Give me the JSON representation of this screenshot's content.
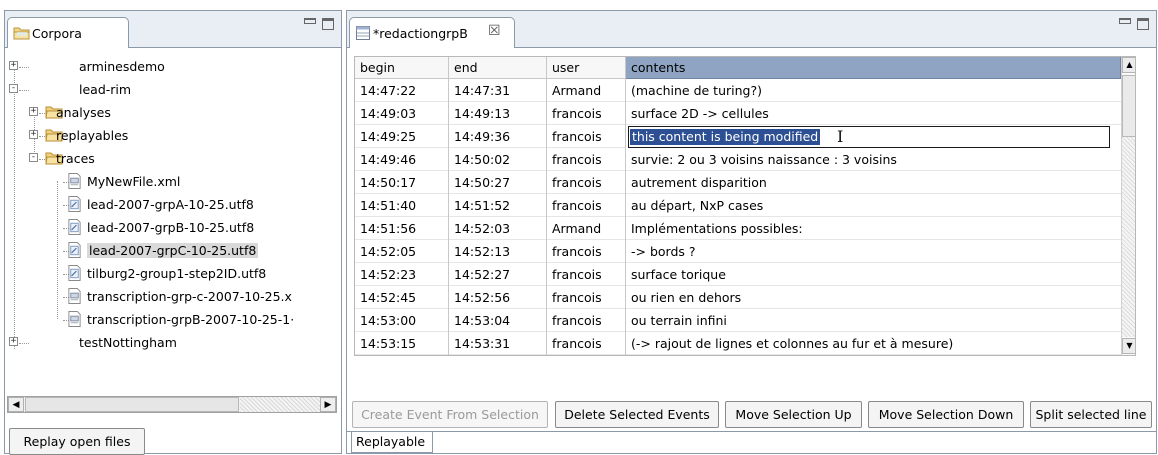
{
  "corpora_view": {
    "tab_title": "Corpora",
    "tree": [
      {
        "label": "arminesdemo",
        "type": "project",
        "expander": "+"
      },
      {
        "label": "lead-rim",
        "type": "project",
        "expander": "−"
      },
      {
        "label": "analyses",
        "type": "folder",
        "expander": "+"
      },
      {
        "label": "replayables",
        "type": "folder",
        "expander": "+"
      },
      {
        "label": "traces",
        "type": "folder",
        "expander": "−"
      },
      {
        "label": "MyNewFile.xml",
        "type": "xml-file"
      },
      {
        "label": "lead-2007-grpA-10-25.utf8",
        "type": "text-file"
      },
      {
        "label": "lead-2007-grpB-10-25.utf8",
        "type": "text-file"
      },
      {
        "label": "lead-2007-grpC-10-25.utf8",
        "type": "text-file",
        "selected": true
      },
      {
        "label": "tilburg2-group1-step2ID.utf8",
        "type": "text-file"
      },
      {
        "label": "transcription-grp-c-2007-10-25.x",
        "type": "xml-file"
      },
      {
        "label": "transcription-grpB-2007-10-25-1·",
        "type": "xml-file"
      },
      {
        "label": "testNottingham",
        "type": "project",
        "expander": "+"
      }
    ],
    "replay_button": "Replay open files"
  },
  "editor": {
    "tab_title": "*redactiongrpB",
    "close_glyph": "☒",
    "columns": [
      "begin",
      "end",
      "user",
      "contents"
    ],
    "sorted_column": "contents",
    "rows": [
      [
        "14:47:22",
        "14:47:31",
        "Armand",
        "(machine de turing?)"
      ],
      [
        "14:49:03",
        "14:49:13",
        "francois",
        "surface 2D -> cellules"
      ],
      [
        "14:49:25",
        "14:49:36",
        "francois",
        "this content is being modified"
      ],
      [
        "14:49:46",
        "14:50:02",
        "francois",
        "survie: 2 ou 3 voisins naissance : 3 voisins"
      ],
      [
        "14:50:17",
        "14:50:27",
        "francois",
        "autrement disparition"
      ],
      [
        "14:51:40",
        "14:51:52",
        "francois",
        "au départ, NxP cases"
      ],
      [
        "14:51:56",
        "14:52:03",
        "Armand",
        "Implémentations possibles:"
      ],
      [
        "14:52:05",
        "14:52:13",
        "francois",
        "-> bords ?"
      ],
      [
        "14:52:23",
        "14:52:27",
        "francois",
        "surface torique"
      ],
      [
        "14:52:45",
        "14:52:56",
        "francois",
        "ou rien en dehors"
      ],
      [
        "14:53:00",
        "14:53:04",
        "francois",
        "ou terrain infini"
      ],
      [
        "14:53:15",
        "14:53:31",
        "francois",
        "(-> rajout de lignes et colonnes au fur et à mesure)"
      ]
    ],
    "editing_row": 2,
    "buttons": {
      "create_event": "Create Event From Selection",
      "delete_events": "Delete Selected Events",
      "move_up": "Move Selection Up",
      "move_down": "Move Selection Down",
      "split_line": "Split selected line"
    },
    "bottom_tab": "Replayable"
  },
  "colors": {
    "tab_bar": "#e9eef4",
    "border": "#8c99a9",
    "sorted_header": "#8ea4c2",
    "text_selection": "#2d4f93",
    "tree_selection": "#d9d9d9"
  }
}
